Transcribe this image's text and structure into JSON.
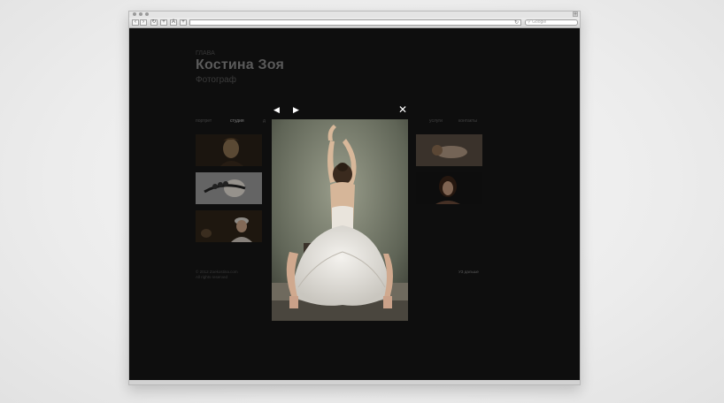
{
  "browser": {
    "search_placeholder": "Google",
    "nav_icons": [
      "back-icon",
      "forward-icon",
      "reload-icon",
      "plus-icon",
      "font-icon",
      "bookmark-icon"
    ]
  },
  "site": {
    "subtitle": "ГЛАВА",
    "name": "Костина Зоя",
    "role": "Фотограф",
    "nav": [
      "портрет",
      "студия",
      "д",
      "услуги",
      "контакты"
    ],
    "footer_left": [
      "© 2012 Zoekostina.com",
      "All rights reserved"
    ],
    "footer_right": "УЗ дальше"
  },
  "lightbox": {
    "prev_icon": "◀",
    "next_icon": "▶",
    "close_icon": "✕"
  },
  "colors": {
    "background": "#161616",
    "page_bg": "#ececec"
  }
}
